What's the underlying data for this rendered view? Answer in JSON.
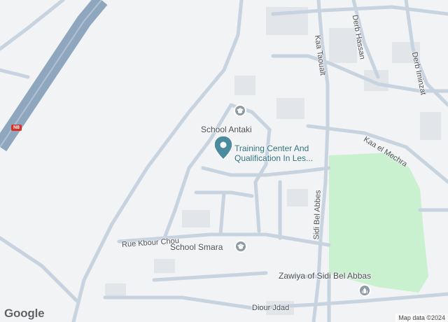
{
  "map": {
    "colors": {
      "background": "#f1f3f4",
      "road": "#c8d3e0",
      "highway": "#8fa6bf",
      "park": "#c9f0cf",
      "building": "#e6e9ec",
      "poi": "#8c9ba5",
      "pin": "#4a8b9e"
    },
    "labels": {
      "school_antaki": "School Antaki",
      "training_center_line1": "Training Center And",
      "training_center_line2": "Qualification In Les...",
      "school_smara": "School Smara",
      "zawiya": "Zawiya of Sidi Bel Abbas",
      "rue_kbour_chou": "Rue Kbour Chou",
      "diour_jdad": "Diour Jdad",
      "kaa_taoualt": "Kaa Taoualt",
      "derb_hassan": "Derb Hassan",
      "derb_iminzat": "Derb Iminzat",
      "kaa_el_mechra": "Kaa el Mechra",
      "sidi_bel_abbes": "Sidi Bel Abbes"
    },
    "highway_shield": "N8",
    "icons": {
      "school": "school-icon",
      "mosque": "mosque-icon",
      "pin": "location-pin-icon"
    }
  },
  "footer": {
    "logo": "Google",
    "attribution": "Map data ©2024"
  }
}
